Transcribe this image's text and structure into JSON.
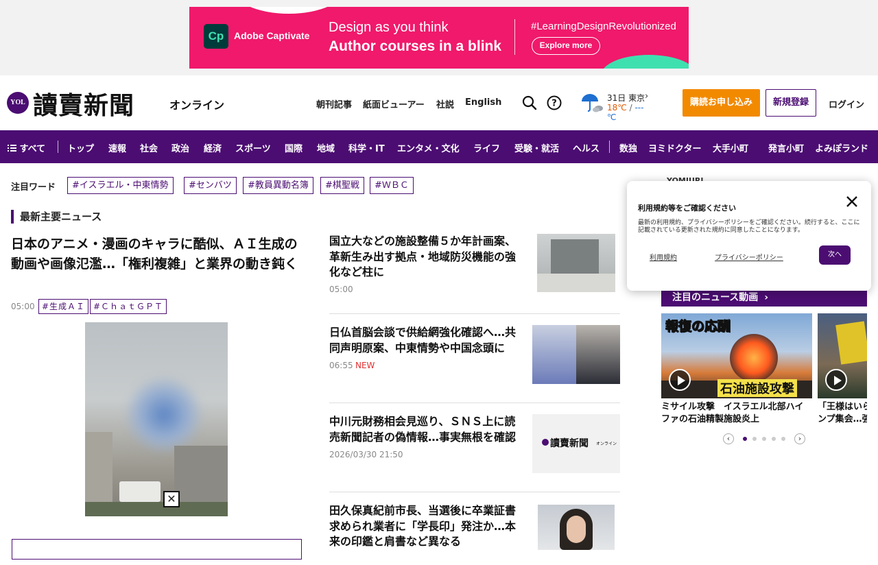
{
  "ad": {
    "brand": "Adobe Captivate",
    "logo_text": "Cp",
    "line1": "Design as you think",
    "line2": "Author courses in a blink",
    "hashtag": "#LearningDesignRevolutionized",
    "cta": "Explore more"
  },
  "header": {
    "logo_badge": "YOL",
    "logo_text": "讀賣新聞",
    "logo_sub": "オンライン",
    "links": [
      "朝刊記事",
      "紙面ビューアー",
      "社説",
      "English"
    ],
    "weather": {
      "date_city": "31日 東京",
      "high": "18℃",
      "low": "---℃",
      "separator": "/"
    },
    "subscribe": "購読お申し込み",
    "register": "新規登録",
    "login": "ログイン"
  },
  "nav": {
    "all": "すべて",
    "items": [
      "トップ",
      "速報",
      "社会",
      "政治",
      "経済",
      "スポーツ",
      "国際",
      "地域",
      "科学・IT",
      "エンタメ・文化",
      "ライフ",
      "受験・就活",
      "ヘルス"
    ],
    "items2": [
      "数独",
      "ヨミドクター",
      "大手小町",
      "発言小町",
      "よみぽランド"
    ]
  },
  "keywords": {
    "label": "注目ワード",
    "tags": [
      "#イスラエル・中東情勢",
      "#センバツ",
      "#教員異動名簿",
      "#棋聖戦",
      "#ＷＢＣ"
    ]
  },
  "section_title": "最新主要ニュース",
  "lead": {
    "title": "日本のアニメ・漫画のキャラに酷似、ＡＩ生成の動画や画像氾濫…「権利複雑」と業界の動き鈍く",
    "time": "05:00",
    "tags": [
      "#生成ＡＩ",
      "#ＣｈａｔＧＰＴ"
    ]
  },
  "articles": [
    {
      "title": "国立大などの施設整備５か年計画案、革新生み出す拠点・地域防災機能の強化など柱に",
      "time": "05:00",
      "badge": ""
    },
    {
      "title": "日仏首脳会談で供給網強化確認へ…共同声明原案、中東情勢や中国念頭に",
      "time": "06:55",
      "badge": "NEW"
    },
    {
      "title": "中川元財務相会見巡り、ＳＮＳ上に読売新聞記者の偽情報…事実無根を確認",
      "time": "2026/03/30 21:50",
      "badge": "",
      "thumb_logo": "讀賣新聞",
      "thumb_sub": "オンライン"
    },
    {
      "title": "田久保真紀前市長、当選後に卒業証書求められ業者に「学長印」発注か…本来の印鑑と肩書など異なる",
      "time": "",
      "badge": ""
    }
  ],
  "right": {
    "brand_peek": "YOMIURI",
    "video_heading": "注目のニュース動画",
    "videos": [
      {
        "overlay_top": "報復の応酬",
        "overlay_bottom": "石油施設攻撃",
        "caption_l1": "ミサイル攻撃　イスラエル北部ハイ",
        "caption_l2": "ファの石油精製施設炎上"
      },
      {
        "overlay_top": "",
        "overlay_bottom": "",
        "caption_l1": "「王様はいら",
        "caption_l2": "ンプ集会…強"
      }
    ],
    "carousel": {
      "prev": "‹",
      "next": "›",
      "active_index": 0,
      "count": 5
    }
  },
  "consent": {
    "title": "利用規約等をご確認ください",
    "body": "最新の利用規約、プライバシーポリシーをご確認ください。続行すると、ここに記載されている更新された規約に同意したことになります。",
    "link_terms": "利用規約",
    "link_privacy": "プライバシーポリシー",
    "next": "次へ"
  },
  "colors": {
    "brand_purple": "#4b0d72",
    "subscribe_orange": "#f28a00",
    "ad_pink": "#f0196b",
    "new_red": "#e03030"
  }
}
